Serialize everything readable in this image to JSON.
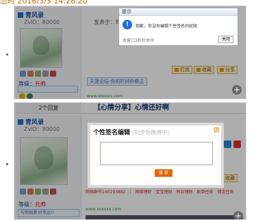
{
  "top_timestamp": "恋时 2016/3/3 14:28:20",
  "shot1": {
    "username": "青风录",
    "zvid": "ZvID：80000",
    "level_label": "等级：",
    "level_value": "元帅",
    "post_info": "发表于：昨天 16:21",
    "tagline": "天涯论坛-你的时间你做主",
    "btn_print": "打赏",
    "btn_fav": "收藏",
    "btn_share": "分享",
    "site_url": "www.xxxxxx.com",
    "dialog": {
      "title": "提示",
      "message": "抱歉，你没有编辑个性签名的权限",
      "note": "本窗口3秒后关闭",
      "close_label": "关闭"
    }
  },
  "shot2": {
    "reply_count": "2个回复",
    "thread_title": "【心情分享】心情还好啊",
    "username": "青风录",
    "zvid": "ZvID：80000",
    "level_label": "等级：",
    "level_value": "元帅",
    "tagline": "与你相遇 好幸运!!",
    "btn_print": "打赏",
    "btn_fav": "收藏",
    "red_links": "网络群号140193882　|　网络理财　宝宝理财　同业理财　剧单任务　佣金任务",
    "site_url": "www.xxxxxx.com",
    "sign_dialog": {
      "title": "个性签名编辑",
      "hint": "(同步到微博中)",
      "close": "x",
      "save_label": "保 存",
      "textarea_value": ""
    }
  },
  "colors": {
    "link_blue": "#1b55a5",
    "accent_orange": "#e0680f",
    "info_blue": "#1d6fd8",
    "red_text": "#dd2222"
  }
}
